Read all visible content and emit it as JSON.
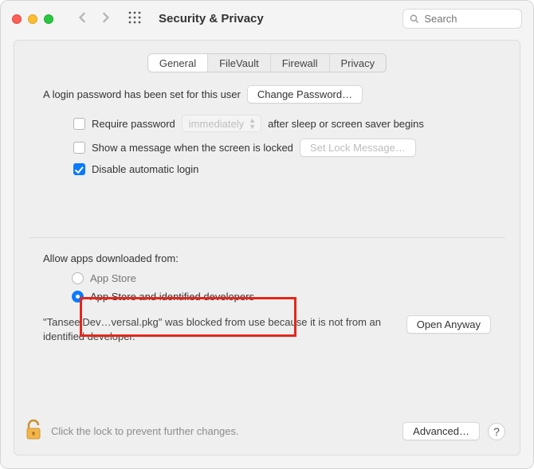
{
  "window": {
    "title": "Security & Privacy"
  },
  "search": {
    "placeholder": "Search"
  },
  "tabs": {
    "general": "General",
    "filevault": "FileVault",
    "firewall": "Firewall",
    "privacy": "Privacy"
  },
  "general": {
    "password_set_text": "A login password has been set for this user",
    "change_password_btn": "Change Password…",
    "require_password_label": "Require password",
    "require_password_delay": "immediately",
    "after_sleep_text": "after sleep or screen saver begins",
    "show_message_label": "Show a message when the screen is locked",
    "set_lock_message_btn": "Set Lock Message…",
    "disable_auto_login_label": "Disable automatic login"
  },
  "allow": {
    "heading": "Allow apps downloaded from:",
    "app_store": "App Store",
    "app_store_dev": "App Store and identified developers",
    "blocked_msg": "\"TanseeiDev…versal.pkg\" was blocked from use because it is not from an identified developer.",
    "open_anyway": "Open Anyway"
  },
  "footer": {
    "lock_text": "Click the lock to prevent further changes.",
    "advanced_btn": "Advanced…"
  }
}
